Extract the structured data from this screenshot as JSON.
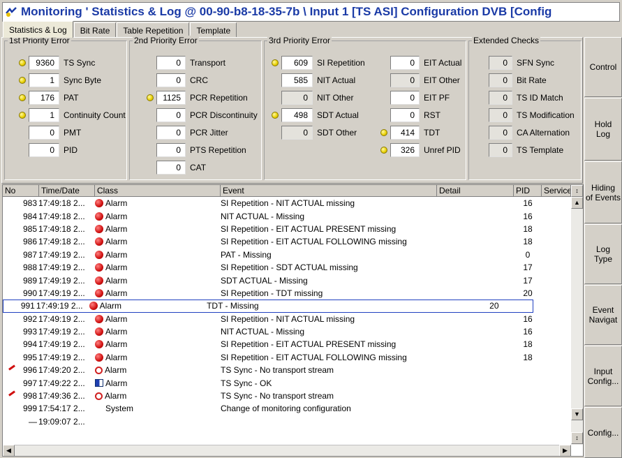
{
  "window": {
    "title": "Monitoring ' Statistics & Log @ 00-90-b8-18-35-7b \\ Input 1 [TS ASI] Configuration DVB [Config"
  },
  "tabs": [
    {
      "label": "Statistics & Log",
      "active": true
    },
    {
      "label": "Bit Rate",
      "active": false
    },
    {
      "label": "Table Repetition",
      "active": false
    },
    {
      "label": "Template",
      "active": false
    }
  ],
  "groups": {
    "first": {
      "title": "1st Priority Error",
      "items": [
        {
          "value": "9360",
          "label": "TS Sync",
          "led": true
        },
        {
          "value": "1",
          "label": "Sync Byte",
          "led": true
        },
        {
          "value": "176",
          "label": "PAT",
          "led": true
        },
        {
          "value": "1",
          "label": "Continuity Count",
          "led": true
        },
        {
          "value": "0",
          "label": "PMT",
          "led": false
        },
        {
          "value": "0",
          "label": "PID",
          "led": false
        }
      ]
    },
    "second": {
      "title": "2nd Priority Error",
      "items": [
        {
          "value": "0",
          "label": "Transport",
          "led": false
        },
        {
          "value": "0",
          "label": "CRC",
          "led": false
        },
        {
          "value": "1125",
          "label": "PCR Repetition",
          "led": true
        },
        {
          "value": "0",
          "label": "PCR Discontinuity",
          "led": false
        },
        {
          "value": "0",
          "label": "PCR Jitter",
          "led": false
        },
        {
          "value": "0",
          "label": "PTS Repetition",
          "led": false
        },
        {
          "value": "0",
          "label": "CAT",
          "led": false
        }
      ]
    },
    "third_a": {
      "title": "3rd Priority Error",
      "items": [
        {
          "value": "609",
          "label": "SI Repetition",
          "led": true
        },
        {
          "value": "585",
          "label": "NIT Actual",
          "led": false
        },
        {
          "value": "0",
          "label": "NIT Other",
          "led": false,
          "dim": true
        },
        {
          "value": "498",
          "label": "SDT Actual",
          "led": true
        },
        {
          "value": "0",
          "label": "SDT Other",
          "led": false,
          "dim": true
        }
      ]
    },
    "third_b": {
      "items": [
        {
          "value": "0",
          "label": "EIT Actual",
          "led": false
        },
        {
          "value": "0",
          "label": "EIT Other",
          "led": false,
          "dim": true
        },
        {
          "value": "0",
          "label": "EIT PF",
          "led": false
        },
        {
          "value": "0",
          "label": "RST",
          "led": false
        },
        {
          "value": "414",
          "label": "TDT",
          "led": true
        },
        {
          "value": "326",
          "label": "Unref PID",
          "led": true
        }
      ]
    },
    "extended": {
      "title": "Extended Checks",
      "items": [
        {
          "value": "0",
          "label": "SFN Sync",
          "led": false,
          "dim": true
        },
        {
          "value": "0",
          "label": "Bit Rate",
          "led": false,
          "dim": true
        },
        {
          "value": "0",
          "label": "TS ID Match",
          "led": false,
          "dim": true
        },
        {
          "value": "0",
          "label": "TS Modification",
          "led": false,
          "dim": true
        },
        {
          "value": "0",
          "label": "CA Alternation",
          "led": false,
          "dim": true
        },
        {
          "value": "0",
          "label": "TS Template",
          "led": false,
          "dim": true
        }
      ]
    }
  },
  "sidebar": [
    {
      "label": "Control"
    },
    {
      "label": "Hold\nLog"
    },
    {
      "label": "Hiding\nof Events"
    },
    {
      "label": "Log\nType"
    },
    {
      "label": "Event\nNavigat"
    },
    {
      "label": "Input\nConfig..."
    },
    {
      "label": "Config..."
    }
  ],
  "log": {
    "columns": [
      "No",
      "Time/Date",
      "Class",
      "Event",
      "Detail",
      "PID",
      "Service"
    ],
    "rows": [
      {
        "no": "983",
        "time": "17:49:18 2...",
        "cls": "Alarm",
        "icon": "alarm",
        "event": "SI Repetition - NIT ACTUAL missing",
        "pid": "16"
      },
      {
        "no": "984",
        "time": "17:49:18 2...",
        "cls": "Alarm",
        "icon": "alarm",
        "event": "NIT ACTUAL - Missing",
        "pid": "16"
      },
      {
        "no": "985",
        "time": "17:49:18 2...",
        "cls": "Alarm",
        "icon": "alarm",
        "event": "SI Repetition - EIT ACTUAL PRESENT missing",
        "pid": "18"
      },
      {
        "no": "986",
        "time": "17:49:18 2...",
        "cls": "Alarm",
        "icon": "alarm",
        "event": "SI Repetition - EIT ACTUAL FOLLOWING missing",
        "pid": "18"
      },
      {
        "no": "987",
        "time": "17:49:19 2...",
        "cls": "Alarm",
        "icon": "alarm",
        "event": "PAT - Missing",
        "pid": "0"
      },
      {
        "no": "988",
        "time": "17:49:19 2...",
        "cls": "Alarm",
        "icon": "alarm",
        "event": "SI Repetition - SDT ACTUAL missing",
        "pid": "17"
      },
      {
        "no": "989",
        "time": "17:49:19 2...",
        "cls": "Alarm",
        "icon": "alarm",
        "event": "SDT ACTUAL - Missing",
        "pid": "17"
      },
      {
        "no": "990",
        "time": "17:49:19 2...",
        "cls": "Alarm",
        "icon": "alarm",
        "event": "SI Repetition - TDT missing",
        "pid": "20"
      },
      {
        "no": "991",
        "time": "17:49:19 2...",
        "cls": "Alarm",
        "icon": "alarm",
        "event": "TDT - Missing",
        "pid": "20",
        "selected": true
      },
      {
        "no": "992",
        "time": "17:49:19 2...",
        "cls": "Alarm",
        "icon": "alarm",
        "event": "SI Repetition - NIT ACTUAL missing",
        "pid": "16"
      },
      {
        "no": "993",
        "time": "17:49:19 2...",
        "cls": "Alarm",
        "icon": "alarm",
        "event": "NIT ACTUAL - Missing",
        "pid": "16"
      },
      {
        "no": "994",
        "time": "17:49:19 2...",
        "cls": "Alarm",
        "icon": "alarm",
        "event": "SI Repetition - EIT ACTUAL PRESENT missing",
        "pid": "18"
      },
      {
        "no": "995",
        "time": "17:49:19 2...",
        "cls": "Alarm",
        "icon": "alarm",
        "event": "SI Repetition - EIT ACTUAL FOLLOWING missing",
        "pid": "18"
      },
      {
        "no": "996",
        "time": "17:49:20 2...",
        "cls": "Alarm",
        "icon": "alarm-ring",
        "event": "TS Sync - No transport stream",
        "pid": "",
        "marker": true
      },
      {
        "no": "997",
        "time": "17:49:22 2...",
        "cls": "Alarm",
        "icon": "ok",
        "event": "TS Sync - OK",
        "pid": ""
      },
      {
        "no": "998",
        "time": "17:49:36 2...",
        "cls": "Alarm",
        "icon": "alarm-ring",
        "event": "TS Sync - No transport stream",
        "pid": "",
        "marker": true
      },
      {
        "no": "999",
        "time": "17:54:17 2...",
        "cls": "System",
        "icon": "none",
        "event": "Change of monitoring configuration",
        "pid": ""
      },
      {
        "no": "—",
        "time": "19:09:07 2...",
        "cls": "",
        "icon": "none",
        "event": "",
        "pid": ""
      }
    ]
  }
}
